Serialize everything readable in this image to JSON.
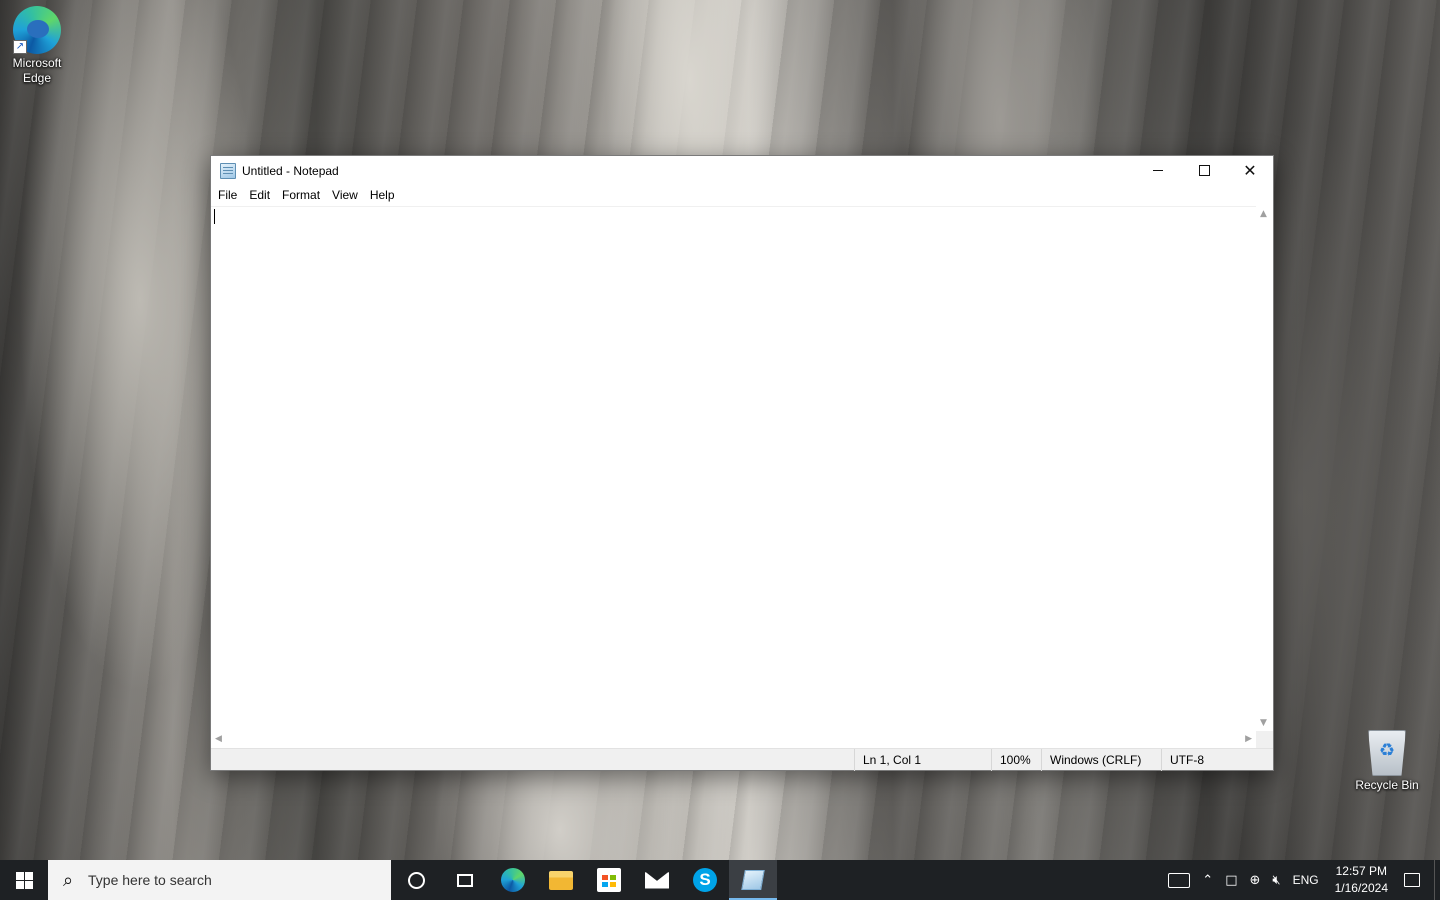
{
  "desktop": {
    "icons": [
      {
        "label_line1": "Microsoft",
        "label_line2": "Edge",
        "icon": "edge-icon"
      },
      {
        "label": "Recycle Bin",
        "icon": "recycle-bin-icon"
      }
    ]
  },
  "notepad": {
    "title": "Untitled - Notepad",
    "menu": [
      "File",
      "Edit",
      "Format",
      "View",
      "Help"
    ],
    "content": "",
    "status": {
      "position": "Ln 1, Col 1",
      "zoom": "100%",
      "line_ending": "Windows (CRLF)",
      "encoding": "UTF-8"
    },
    "controls": {
      "minimize": "minimize-icon",
      "maximize": "maximize-icon",
      "close": "close-icon"
    }
  },
  "taskbar": {
    "search_placeholder": "Type here to search",
    "pinned": [
      "cortana",
      "task-view",
      "microsoft-edge",
      "file-explorer",
      "microsoft-store",
      "mail",
      "skype",
      "notepad"
    ],
    "active_app": "notepad",
    "tray": {
      "language": "ENG",
      "time": "12:57 PM",
      "date": "1/16/2024"
    }
  },
  "colors": {
    "taskbar": "#1e2124",
    "active_indicator": "#76b9ed",
    "statusbar": "#f0f0f0"
  }
}
